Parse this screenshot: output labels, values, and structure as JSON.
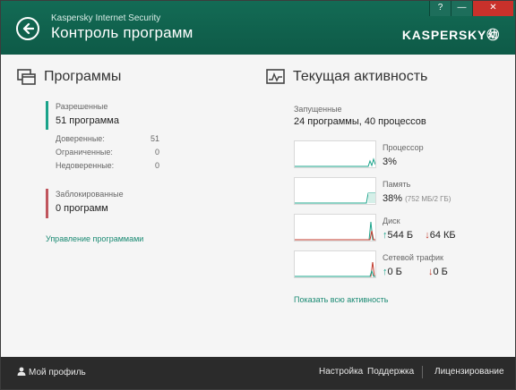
{
  "header": {
    "app_name": "Kaspersky Internet Security",
    "title": "Контроль программ",
    "logo": "KASPERSKY㉅",
    "help": "?",
    "minimize": "—",
    "close": "✕"
  },
  "programs": {
    "heading": "Программы",
    "allowed_caption": "Разрешенные",
    "allowed_value": "51 программа",
    "details": [
      {
        "label": "Доверенные:",
        "value": "51"
      },
      {
        "label": "Ограниченные:",
        "value": "0"
      },
      {
        "label": "Недоверенные:",
        "value": "0"
      }
    ],
    "blocked_caption": "Заблокированные",
    "blocked_value": "0 программ",
    "manage_link": "Управление программами"
  },
  "activity": {
    "heading": "Текущая активность",
    "running_caption": "Запущенные",
    "running_value": "24 программы, 40 процессов",
    "cpu_caption": "Процессор",
    "cpu_value": "3%",
    "memory_caption": "Память",
    "memory_value": "38%",
    "memory_detail": "(752 МБ/2 ГБ)",
    "disk_caption": "Диск",
    "disk_up": "544 Б",
    "disk_down": "64 КБ",
    "net_caption": "Сетевой трафик",
    "net_up": "0 Б",
    "net_down": "0 Б",
    "show_all_link": "Показать всю активность",
    "up_arrow": "↑",
    "down_arrow": "↓"
  },
  "footer": {
    "profile": "Мой профиль",
    "settings": "Настройка",
    "support": "Поддержка",
    "licensing": "Лицензирование"
  },
  "colors": {
    "header": "#136b55",
    "accent": "#1aa38a",
    "blocked": "#c0555d",
    "footer": "#2b2b2b"
  }
}
